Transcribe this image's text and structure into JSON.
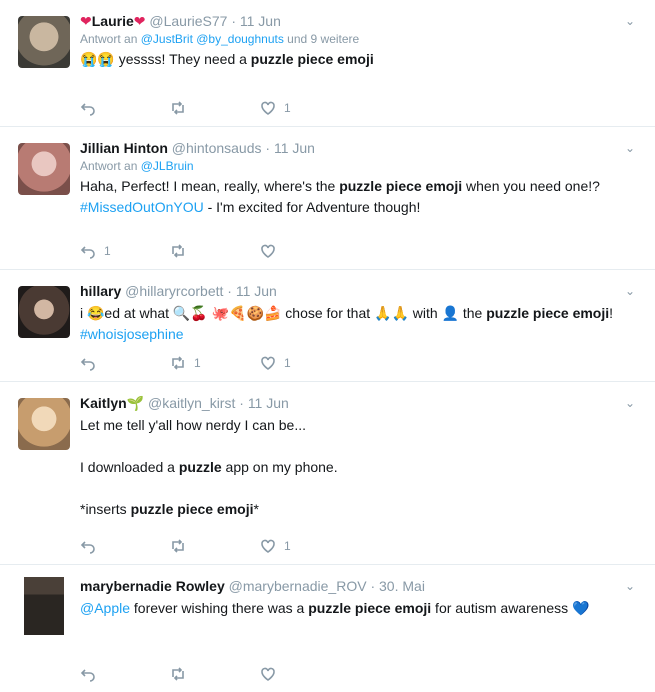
{
  "tweets": [
    {
      "name": "Laurie",
      "name_prefix": "❤",
      "name_suffix": "❤",
      "handle": "@LaurieS77",
      "date": "11 Jun",
      "replying_prefix": "Antwort an",
      "replying_links": "@JustBrit @by_doughnuts",
      "replying_suffix": "und 9 weitere",
      "text_parts": [
        "😭😭 yessss! They need a ",
        "puzzle piece emoji",
        ""
      ],
      "reply_count": "",
      "retweet_count": "",
      "like_count": "1"
    },
    {
      "name": "Jillian Hinton",
      "handle": "@hintonsauds",
      "date": "11 Jun",
      "replying_prefix": "Antwort an",
      "replying_links": "@JLBruin",
      "text_parts": [
        "Haha, Perfect! I mean, really, where's the ",
        "puzzle piece emoji",
        " when you need one!? "
      ],
      "hashtag": "#MissedOutOnYOU",
      "text_end": " - I'm excited for Adventure though!",
      "reply_count": "1",
      "retweet_count": "",
      "like_count": ""
    },
    {
      "name": "hillary",
      "handle": "@hillaryrcorbett",
      "date": "11 Jun",
      "text_parts": [
        "i 😂ed at what 🔍🍒 🐙🍕🍪🍰 chose for that 🙏🙏 with 👤 the ",
        "puzzle piece emoji",
        "! "
      ],
      "hashtag": "#whoisjosephine",
      "reply_count": "",
      "retweet_count": "1",
      "like_count": "1"
    },
    {
      "name": "Kaitlyn",
      "name_suffix": "🌱",
      "handle": "@kaitlyn_kirst",
      "date": "11 Jun",
      "text_lines": [
        "Let me tell y'all how nerdy I can be...",
        "",
        "I downloaded a ",
        "puzzle",
        " app on my phone.",
        "",
        "*inserts ",
        "puzzle piece emoji",
        "*"
      ],
      "reply_count": "",
      "retweet_count": "",
      "like_count": "1"
    },
    {
      "name": "marybernadie Rowley",
      "handle": "@marybernadie_ROV",
      "date": "30. Mai",
      "replying_links": "@Apple",
      "text_parts": [
        " forever wishing there was a ",
        "puzzle piece emoji",
        " for autism awareness "
      ],
      "text_end_emoji": "💙",
      "reply_count": "",
      "retweet_count": "",
      "like_count": ""
    }
  ],
  "icons": {
    "reply": "reply-icon",
    "retweet": "retweet-icon",
    "like": "like-icon",
    "more": "chevron-down-icon"
  },
  "colors": {
    "link": "#1da1f2",
    "muted": "#8899a6",
    "divider": "#e6ecf0"
  }
}
